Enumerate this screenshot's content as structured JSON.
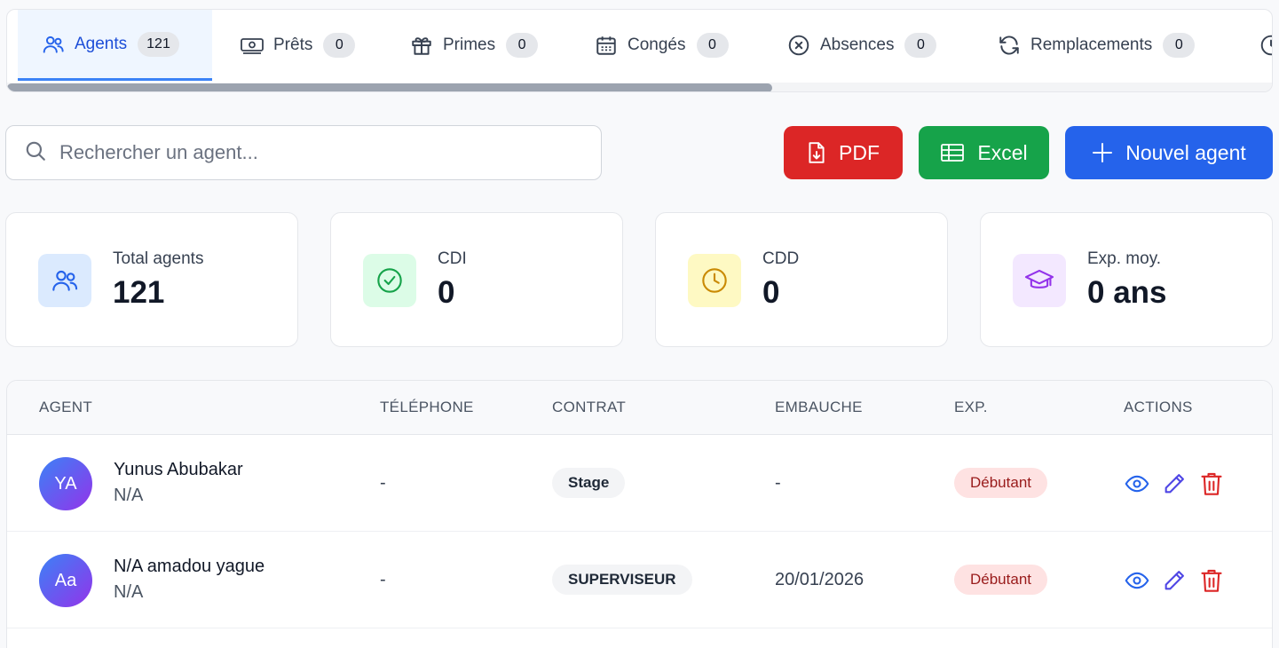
{
  "tabs": [
    {
      "label": "Agents",
      "count": "121",
      "icon": "users-icon",
      "active": true
    },
    {
      "label": "Prêts",
      "count": "0",
      "icon": "banknote-icon"
    },
    {
      "label": "Primes",
      "count": "0",
      "icon": "gift-icon"
    },
    {
      "label": "Congés",
      "count": "0",
      "icon": "calendar-icon"
    },
    {
      "label": "Absences",
      "count": "0",
      "icon": "x-circle-icon"
    },
    {
      "label": "Remplacements",
      "count": "0",
      "icon": "refresh-icon"
    }
  ],
  "search": {
    "placeholder": "Rechercher un agent..."
  },
  "buttons": {
    "pdf": "PDF",
    "excel": "Excel",
    "new": "Nouvel agent"
  },
  "stats": [
    {
      "label": "Total agents",
      "value": "121",
      "icon": "users-icon",
      "color": "#2563eb",
      "bg": "#dbeafe"
    },
    {
      "label": "CDI",
      "value": "0",
      "icon": "check-circle-icon",
      "color": "#16a34a",
      "bg": "#dcfce7"
    },
    {
      "label": "CDD",
      "value": "0",
      "icon": "clock-icon",
      "color": "#ca8a04",
      "bg": "#fef9c3"
    },
    {
      "label": "Exp. moy.",
      "value": "0 ans",
      "icon": "graduation-cap-icon",
      "color": "#9333ea",
      "bg": "#f3e8ff"
    }
  ],
  "table": {
    "headers": [
      "AGENT",
      "TÉLÉPHONE",
      "CONTRAT",
      "EMBAUCHE",
      "EXP.",
      "ACTIONS"
    ],
    "rows": [
      {
        "initials": "YA",
        "name": "Yunus Abubakar",
        "sub": "N/A",
        "phone": "-",
        "contract": "Stage",
        "hired": "-",
        "exp": "Débutant"
      },
      {
        "initials": "Aa",
        "name": "N/A amadou yague",
        "sub": "N/A",
        "phone": "-",
        "contract": "SUPERVISEUR",
        "hired": "20/01/2026",
        "exp": "Débutant"
      }
    ]
  },
  "colors": {
    "primary": "#2563eb",
    "danger": "#dc2626",
    "success": "#16a34a"
  }
}
